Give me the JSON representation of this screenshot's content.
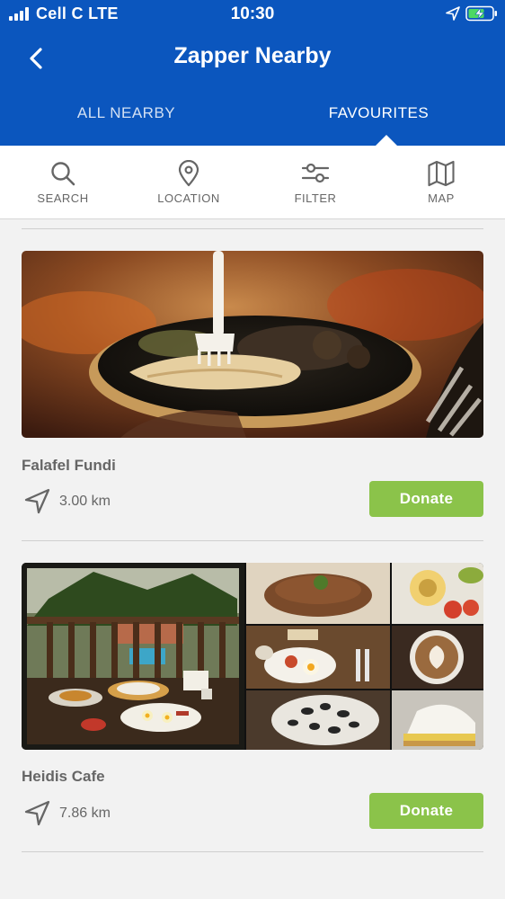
{
  "status_bar": {
    "carrier": "Cell C  LTE",
    "time": "10:30"
  },
  "header": {
    "title": "Zapper Nearby",
    "back_icon": "chevron-left-icon"
  },
  "tabs": [
    {
      "label": "ALL NEARBY",
      "active": false
    },
    {
      "label": "FAVOURITES",
      "active": true
    }
  ],
  "toolbar": {
    "items": [
      {
        "label": "SEARCH",
        "icon": "search-icon"
      },
      {
        "label": "LOCATION",
        "icon": "location-pin-icon"
      },
      {
        "label": "FILTER",
        "icon": "sliders-icon"
      },
      {
        "label": "MAP",
        "icon": "map-icon"
      }
    ]
  },
  "places": [
    {
      "name": "Falafel Fundi",
      "distance": "3.00 km",
      "donate_label": "Donate",
      "image": "food-photo-flatbread-with-fork"
    },
    {
      "name": "Heidis Cafe",
      "distance": "7.86 km",
      "donate_label": "Donate",
      "image": "photo-collage-terrace-breakfast-coffee-pies"
    }
  ],
  "colors": {
    "header_blue": "#0b56be",
    "donate_green": "#8bc34a",
    "background": "#f2f2f2",
    "text_gray": "#666666"
  }
}
